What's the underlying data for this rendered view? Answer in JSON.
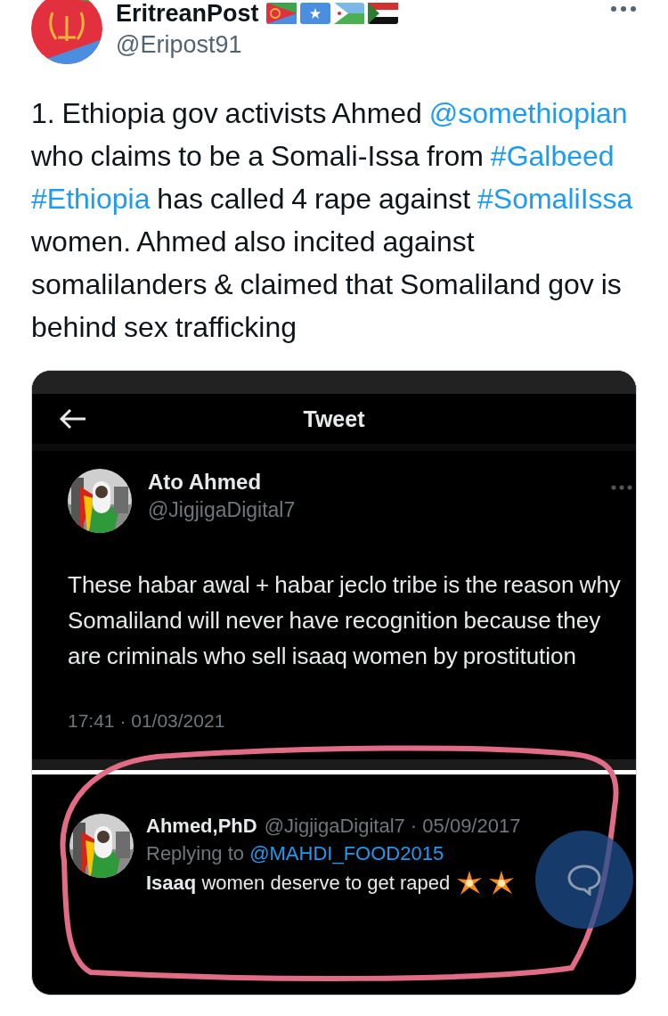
{
  "author": {
    "name": "EritreanPost",
    "handle": "@Eripost91"
  },
  "body": [
    {
      "kind": "text",
      "text": "1. Ethiopia gov activists Ahmed"
    },
    {
      "kind": "link",
      "text": "@somethiopian"
    },
    {
      "kind": "text",
      "text": "who claims to be a Somali-Issa from"
    },
    {
      "kind": "link",
      "text": "#Galbeed"
    },
    {
      "kind": "link",
      "text": "#Ethiopia"
    },
    {
      "kind": "text",
      "text": "has called 4 rape against"
    },
    {
      "kind": "link",
      "text": "#SomaliIssa"
    },
    {
      "kind": "text",
      "text": "women. Ahmed also incited against somalilanders & claimed that Somaliland gov is behind sex trafficking"
    }
  ],
  "embedded": {
    "header_title": "Tweet",
    "tweet": {
      "name": "Ato Ahmed",
      "handle": "@JigjigaDigital7",
      "text": "These habar awal + habar jeclo tribe is the reason why Somaliland will never have recognition because they are criminals who sell isaaq women by prostitution",
      "timestamp": "17:41 · 01/03/2021"
    },
    "reply": {
      "name": "Ahmed,PhD",
      "handle_date": "@JigjigaDigital7 · 05/09/2017",
      "replying_label": "Replying to",
      "replying_to": "@MAHDI_FOOD2015",
      "text": "**Isaaq** women deserve to get raped"
    }
  }
}
